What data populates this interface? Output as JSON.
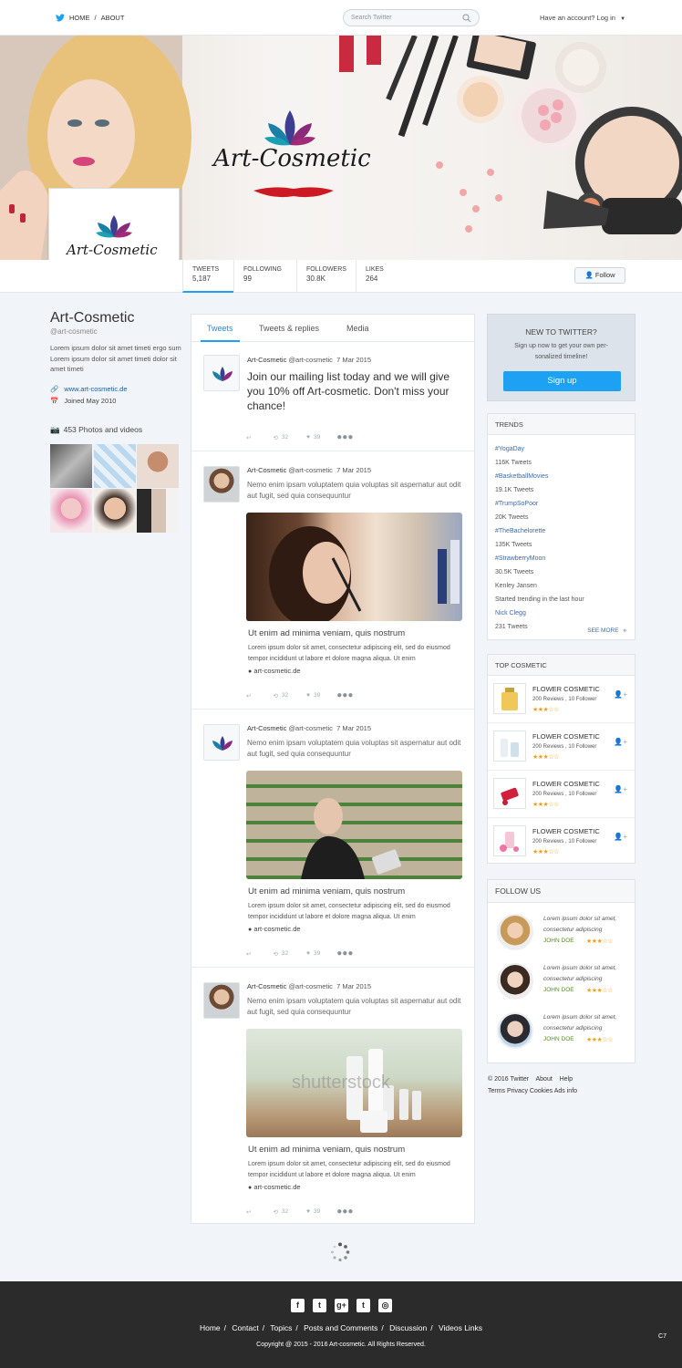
{
  "nav": {
    "home": "HOME",
    "sep": "/",
    "about": "ABOUT"
  },
  "search": {
    "placeholder": "Search Twitter"
  },
  "account": {
    "label": "Have an account? Log in"
  },
  "brand": {
    "name": "Art-Cosmetic"
  },
  "stats": [
    {
      "label": "TWEETS",
      "value": "5,187"
    },
    {
      "label": "FOLLOWING",
      "value": "99"
    },
    {
      "label": "FOLLOWERS",
      "value": "30.8K"
    },
    {
      "label": "LIKES",
      "value": "264"
    }
  ],
  "follow_button": "Follow",
  "profile": {
    "name": "Art-Cosmetic",
    "handle": "@art-cosmetic",
    "bio": "Lorem ipsum dolor sit amet timeti ergo sum Lorem ipsum dolor sit amet timeti dolor sit amet timeti",
    "website": "www.art-cosmetic.de",
    "joined": "Joined May 2010",
    "photos": "453 Photos and videos"
  },
  "tabs": {
    "tweets": "Tweets",
    "replies": "Tweets & replies",
    "media": "Media"
  },
  "tweets": [
    {
      "name": "Art-Cosmetic",
      "handle": "@art-cosmetic",
      "date": "7 Mar 2015",
      "text": "Join our mailing list today and we will give you 10% off Art-cosmetic. Don't miss your chance!",
      "retweets": "32",
      "likes": "39"
    },
    {
      "name": "Art-Cosmetic",
      "handle": "@art-cosmetic",
      "date": "7 Mar 2015",
      "text": "Nemo enim ipsam voluptatem quia voluptas sit aspernatur aut odit aut fugit, sed quia consequuntur",
      "link_title": "Ut enim ad minima veniam, quis nostrum",
      "link_desc": "Lorem ipsum dolor sit amet, consectetur adipiscing elit, sed do eiusmod tempor incididunt ut labore et dolore magna aliqua. Ut enim",
      "link_url": "art-cosmetic.de",
      "retweets": "32",
      "likes": "39"
    },
    {
      "name": "Art-Cosmetic",
      "handle": "@art-cosmetic",
      "date": "7 Mar 2015",
      "text": "Nemo enim ipsam voluptatem quia voluptas sit aspernatur aut odit aut fugit, sed quia consequuntur",
      "link_title": "Ut enim ad minima veniam, quis nostrum",
      "link_desc": "Lorem ipsum dolor sit amet, consectetur adipiscing elit, sed do eiusmod tempor incididunt ut labore et dolore magna aliqua. Ut enim",
      "link_url": "art-cosmetic.de",
      "retweets": "32",
      "likes": "39"
    },
    {
      "name": "Art-Cosmetic",
      "handle": "@art-cosmetic",
      "date": "7 Mar 2015",
      "text": "Nemo enim ipsam voluptatem quia voluptas sit aspernatur aut odit aut fugit, sed quia consequuntur",
      "link_title": "Ut enim ad minima veniam, quis nostrum",
      "link_desc": "Lorem ipsum dolor sit amet, consectetur adipiscing elit, sed do eiusmod tempor incididunt ut labore et dolore magna aliqua. Ut enim",
      "link_url": "art-cosmetic.de",
      "retweets": "32",
      "likes": "39",
      "watermark": "shutterstock"
    }
  ],
  "new_to_twitter": {
    "title": "NEW TO TWITTER?",
    "text": "Sign up now to get your own per-sonalized timeline!",
    "button": "Sign up"
  },
  "trends": {
    "title": "TRENDS",
    "items": [
      {
        "tag": "#YogaDay",
        "count": "116K Tweets"
      },
      {
        "tag": "#BasketballMovies",
        "count": "19.1K Tweets"
      },
      {
        "tag": "#TrumpSoPoor",
        "count": "20K Tweets"
      },
      {
        "tag": "#TheBachelorette",
        "count": "135K Tweets"
      },
      {
        "tag": "#StrawberryMoon",
        "count": "30.5K Tweets"
      }
    ],
    "extra1": "Kenley Jansen",
    "extra2": "Started trending in the last hour",
    "extra3": "Nick Clegg",
    "extra4": "231 Tweets",
    "see_more": "SEE MORE"
  },
  "top_cosmetic": {
    "title": "TOP COSMETIC",
    "items": [
      {
        "title": "FLOWER COSMETIC",
        "reviews": "200 Reviews , 10 Follower",
        "rating": 3
      },
      {
        "title": "FLOWER COSMETIC",
        "reviews": "200 Reviews , 10 Follower",
        "rating": 3
      },
      {
        "title": "FLOWER COSMETIC",
        "reviews": "200 Reviews , 10 Follower",
        "rating": 3
      },
      {
        "title": "FLOWER COSMETIC",
        "reviews": "200 Reviews , 10 Follower",
        "rating": 3
      }
    ]
  },
  "follow_us": {
    "title": "FOLLOW US",
    "items": [
      {
        "quote": "Lorem ipsum dolor sit amet, consectetur adipiscing",
        "name": "JOHN DOE",
        "rating": 3
      },
      {
        "quote": "Lorem ipsum dolor sit amet, consectetur adipiscing",
        "name": "JOHN DOE",
        "rating": 3
      },
      {
        "quote": "Lorem ipsum dolor sit amet, consectetur adipiscing",
        "name": "JOHN DOE",
        "rating": 3
      }
    ]
  },
  "copyright_side": {
    "line1": "© 2016 Twitter    About    Help",
    "line2": "Terms Privacy Cookies Ads info"
  },
  "footer": {
    "links": [
      "Home",
      "Contact",
      "Topics",
      "Posts and Comments",
      "Discussion",
      "Videos Links"
    ],
    "sep": "/",
    "copyright": "Copyright @ 2015 - 2016 Art-cosmetic. All Rights Reserved.",
    "corner": "C7",
    "social_icons": [
      "facebook-icon",
      "twitter-icon",
      "google-plus-icon",
      "tumblr-icon",
      "instagram-icon"
    ]
  },
  "colors": {
    "accent": "#1da1f2",
    "link": "#3b6aa6",
    "star": "#f0a01e",
    "footer": "#2b2b2b"
  }
}
